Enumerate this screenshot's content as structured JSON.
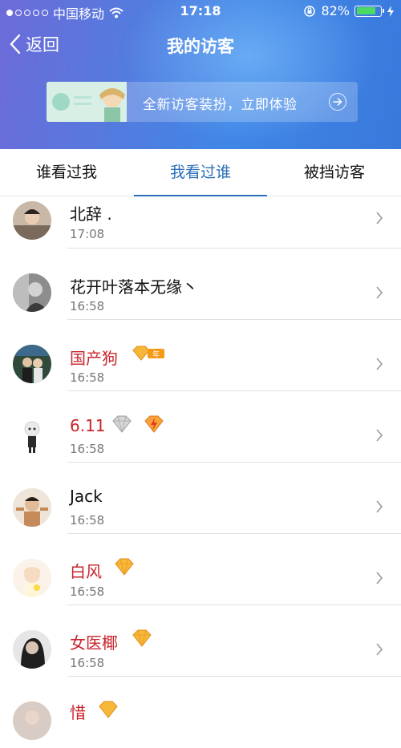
{
  "status": {
    "carrier": "中国移动",
    "time": "17:18",
    "battery": "82%",
    "battery_level": 0.82
  },
  "nav": {
    "back_label": "返回",
    "title": "我的访客"
  },
  "promo": {
    "text": "全新访客装扮，立即体验"
  },
  "tabs": [
    {
      "label": "谁看过我",
      "active": false
    },
    {
      "label": "我看过谁",
      "active": true
    },
    {
      "label": "被挡访客",
      "active": false
    }
  ],
  "visitors": [
    {
      "name": "北辞 .",
      "time": "17:08",
      "vip": false
    },
    {
      "name": "花开叶落本无缘丶",
      "time": "16:58",
      "vip": false
    },
    {
      "name": "国产狗",
      "time": "16:58",
      "vip": true,
      "badge_text": "年"
    },
    {
      "name": "6.11",
      "time": "16:58",
      "vip": true
    },
    {
      "name": "Jack",
      "time": "16:58",
      "vip": false
    },
    {
      "name": "白风",
      "time": "16:58",
      "vip": true
    },
    {
      "name": "女医椰",
      "time": "16:58",
      "vip": true
    },
    {
      "name": "惜",
      "time": "",
      "vip": true
    }
  ],
  "colors": {
    "accent": "#2a6fb8",
    "vip_name": "#c8242b",
    "battery_fill": "#4cd964"
  }
}
